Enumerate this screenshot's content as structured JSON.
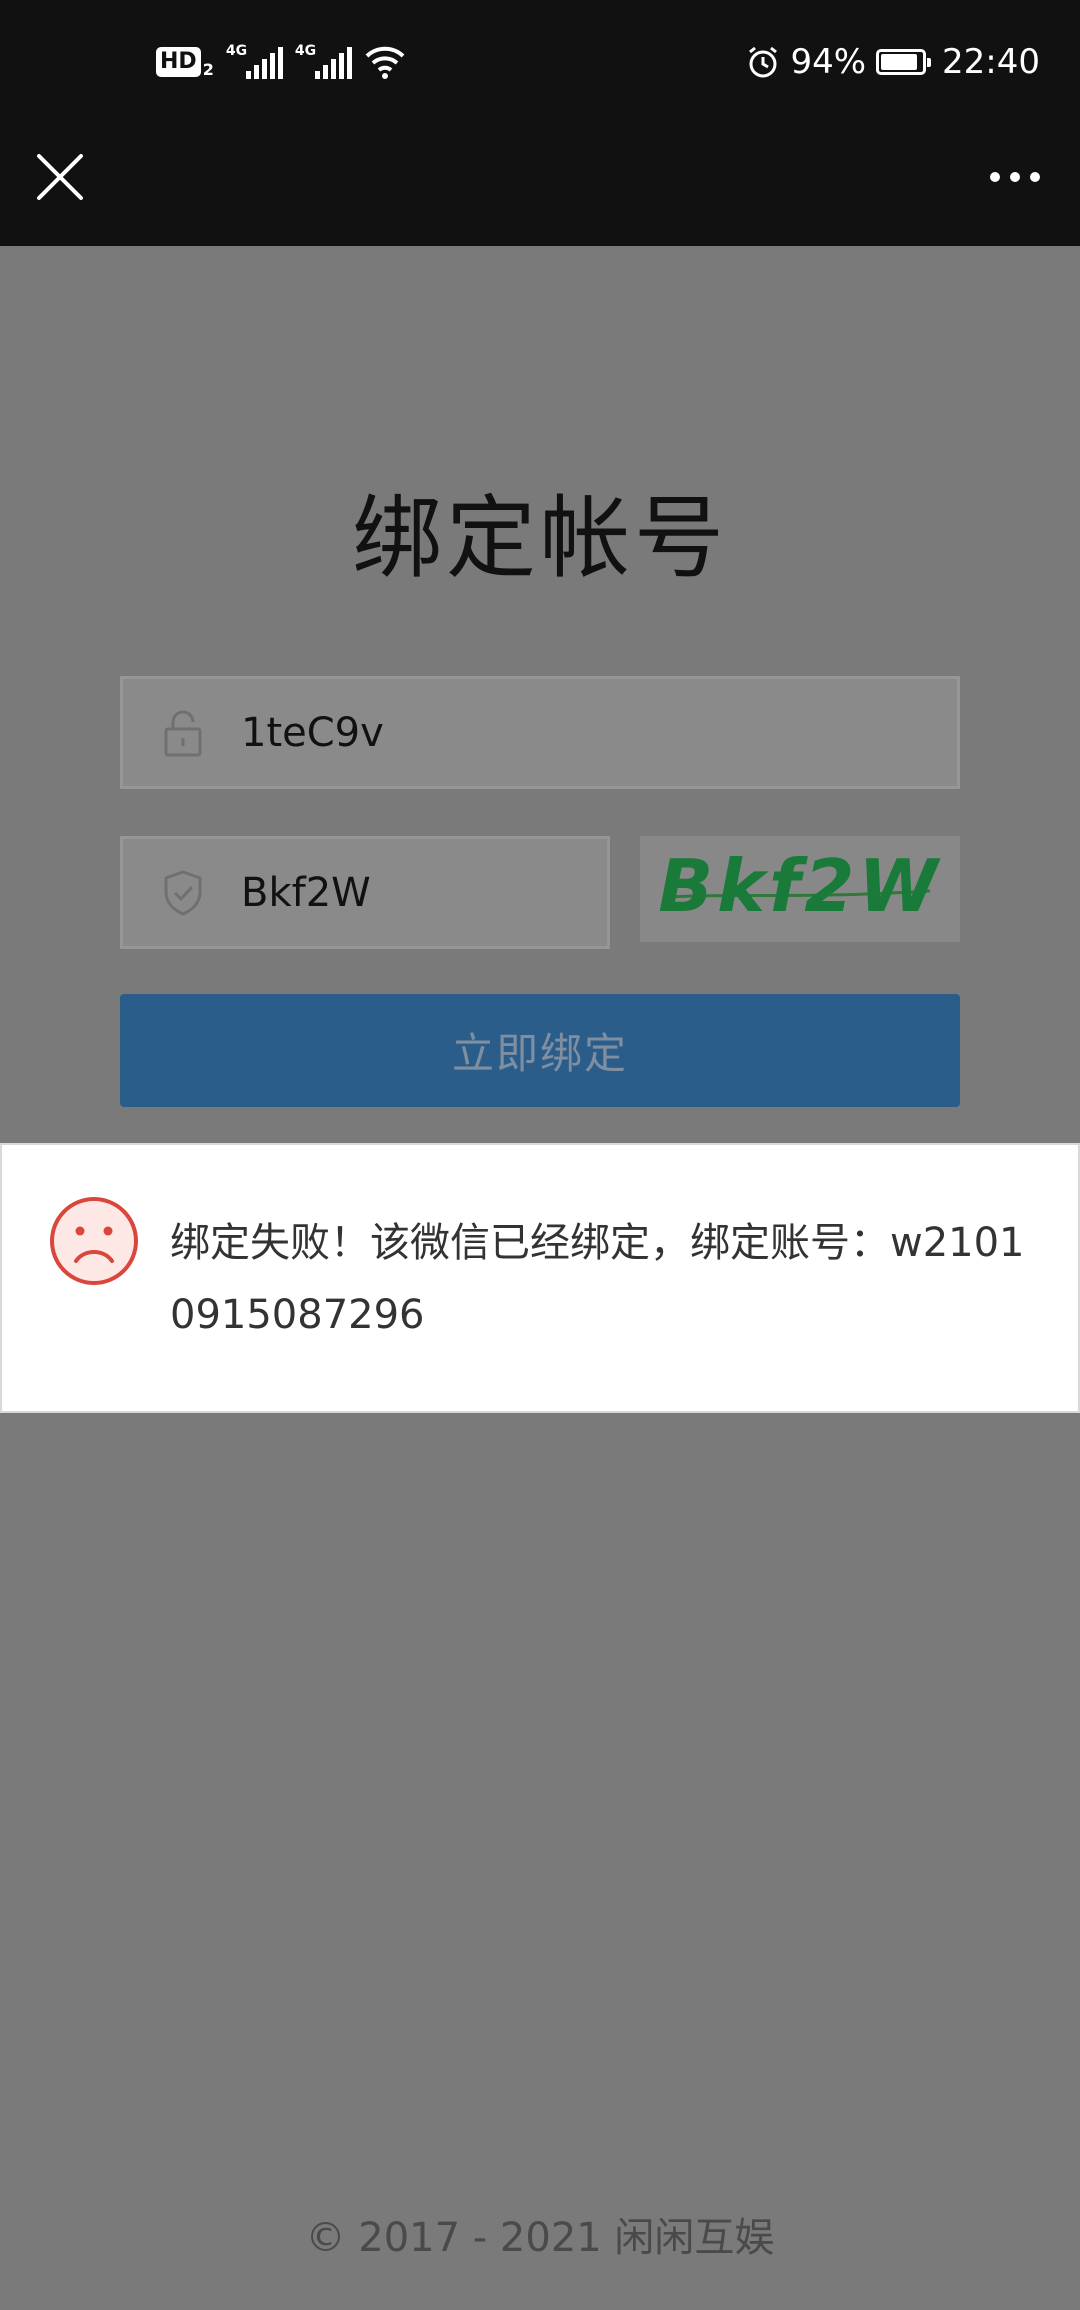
{
  "status_bar": {
    "hd_label": "HD",
    "hd_sub": "2",
    "signal1_label": "4G",
    "signal2_label": "4G",
    "battery_percent": "94%",
    "battery_level": 0.94,
    "time": "22:40"
  },
  "navbar": {
    "close_icon": "close-icon",
    "more_icon": "more-icon"
  },
  "page": {
    "title": "绑定帐号",
    "account_field": {
      "value": "1teC9v",
      "icon": "lock-icon"
    },
    "captcha_field": {
      "value": "Bkf2W",
      "icon": "shield-check-icon"
    },
    "captcha_image_text": "Bkf2W",
    "submit_label": "立即绑定"
  },
  "dialog": {
    "icon": "sad-face-icon",
    "message": "绑定失败！该微信已经绑定，绑定账号：w21010915087296"
  },
  "footer": {
    "copyright": "© 2017 - 2021 闲闲互娱"
  },
  "colors": {
    "background_overlay": "#7a7a7a",
    "button": "#2a5d8a",
    "captcha_text": "#1a7a3a",
    "error_icon": "#d9463c"
  }
}
